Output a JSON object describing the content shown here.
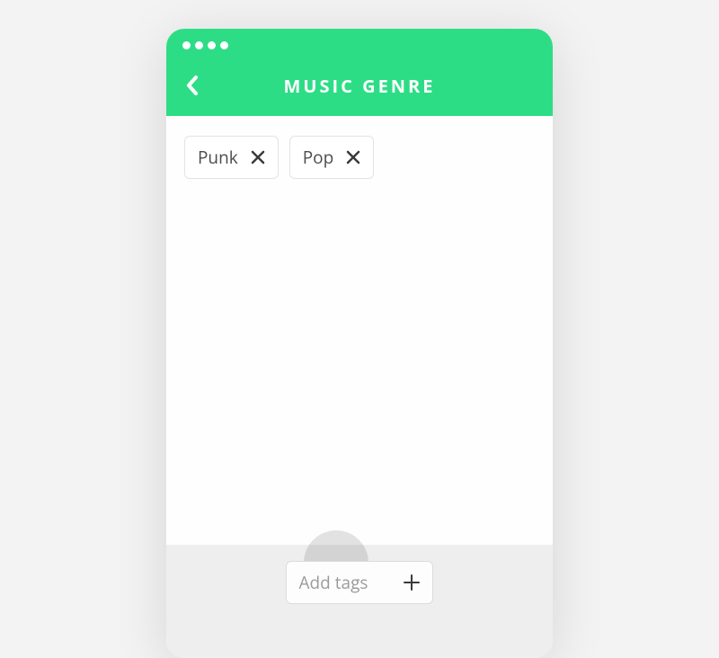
{
  "header": {
    "title": "MUSIC GENRE"
  },
  "tags": [
    {
      "label": "Punk"
    },
    {
      "label": "Pop"
    }
  ],
  "footer": {
    "add_placeholder": "Add tags"
  },
  "colors": {
    "accent": "#2ddd86"
  }
}
